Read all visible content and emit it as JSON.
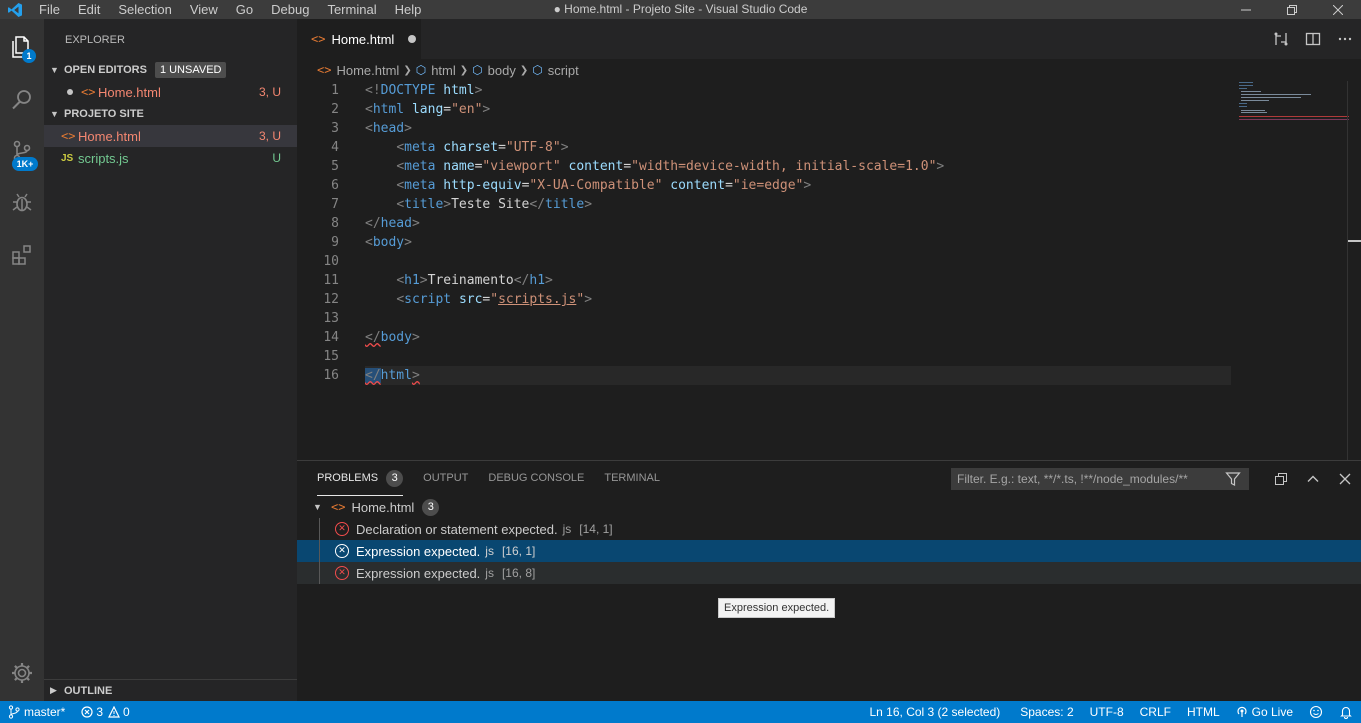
{
  "titlebar": {
    "menu": [
      "File",
      "Edit",
      "Selection",
      "View",
      "Go",
      "Debug",
      "Terminal",
      "Help"
    ],
    "title": "● Home.html - Projeto Site - Visual Studio Code"
  },
  "activity": {
    "explorer_badge": "1",
    "scm_badge": "1K+"
  },
  "sidebar": {
    "title": "EXPLORER",
    "open_editors": {
      "label": "OPEN EDITORS",
      "badge": "1 UNSAVED",
      "items": [
        {
          "name": "Home.html",
          "status": "3, U"
        }
      ]
    },
    "project": {
      "label": "PROJETO SITE",
      "items": [
        {
          "name": "Home.html",
          "status": "3, U",
          "icon": "<>"
        },
        {
          "name": "scripts.js",
          "status": "U",
          "icon": "JS"
        }
      ]
    },
    "outline": "OUTLINE"
  },
  "editor": {
    "tab": "Home.html",
    "breadcrumbs": [
      "Home.html",
      "html",
      "body",
      "script"
    ],
    "line_numbers": [
      "1",
      "2",
      "3",
      "4",
      "5",
      "6",
      "7",
      "8",
      "9",
      "10",
      "11",
      "12",
      "13",
      "14",
      "15",
      "16"
    ]
  },
  "panel": {
    "tabs": [
      "PROBLEMS",
      "OUTPUT",
      "DEBUG CONSOLE",
      "TERMINAL"
    ],
    "problems_count": "3",
    "filter_placeholder": "Filter. E.g.: text, **/*.ts, !**/node_modules/**",
    "file": {
      "name": "Home.html",
      "count": "3"
    },
    "problems": [
      {
        "message": "Declaration or statement expected.",
        "source": "js",
        "position": "[14, 1]"
      },
      {
        "message": "Expression expected.",
        "source": "js",
        "position": "[16, 1]"
      },
      {
        "message": "Expression expected.",
        "source": "js",
        "position": "[16, 8]"
      }
    ],
    "tooltip": "Expression expected."
  },
  "statusbar": {
    "branch": "master*",
    "errors": "3",
    "warnings": "0",
    "cursor": "Ln 16, Col 3 (2 selected)",
    "spaces": "Spaces: 2",
    "encoding": "UTF-8",
    "eol": "CRLF",
    "language": "HTML",
    "golive": "Go Live"
  },
  "colors": {
    "accent": "#007acc",
    "error": "#f14c4c",
    "untracked": "#73c991",
    "modified_red": "#f48771"
  }
}
